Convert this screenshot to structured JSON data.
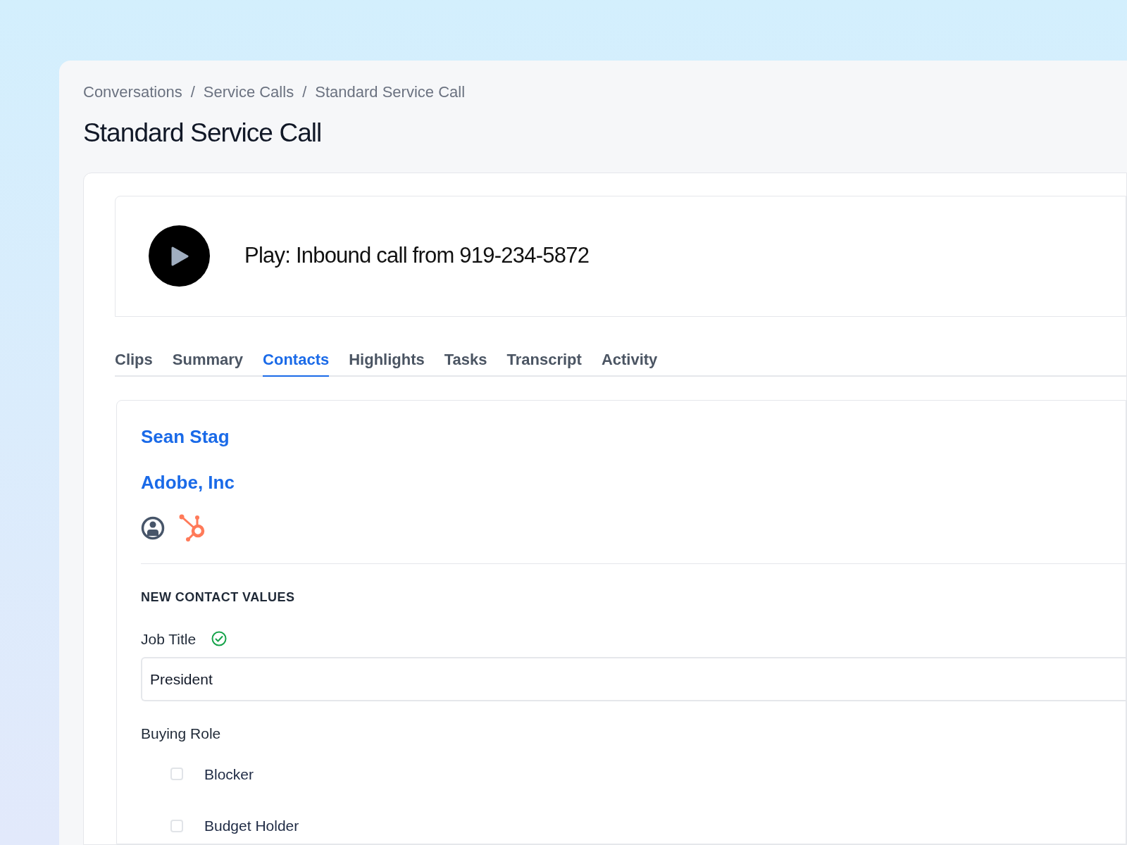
{
  "breadcrumb": [
    "Conversations",
    "Service Calls",
    "Standard Service Call"
  ],
  "breadcrumb_separator": "/",
  "title": "Standard Service Call",
  "player": {
    "label": "Play: Inbound call from 919-234-5872"
  },
  "tabs": [
    {
      "label": "Clips",
      "selected": false
    },
    {
      "label": "Summary",
      "selected": false
    },
    {
      "label": "Contacts",
      "selected": true
    },
    {
      "label": "Highlights",
      "selected": false
    },
    {
      "label": "Tasks",
      "selected": false
    },
    {
      "label": "Transcript",
      "selected": false
    },
    {
      "label": "Activity",
      "selected": false
    }
  ],
  "contact": {
    "name": "Sean Stag",
    "company": "Adobe, Inc"
  },
  "section_heading": "NEW CONTACT VALUES",
  "job_title": {
    "label": "Job Title",
    "verified": true,
    "value": "President"
  },
  "buying_role": {
    "label": "Buying Role",
    "options": [
      {
        "label": "Blocker",
        "checked": false
      },
      {
        "label": "Budget Holder",
        "checked": false
      }
    ]
  }
}
